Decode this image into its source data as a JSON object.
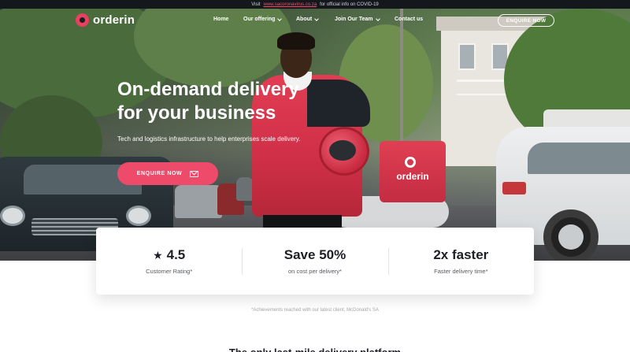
{
  "topbar": {
    "prefix": "Visit",
    "link_text": "www.sacoronavirus.co.za",
    "suffix": "for official info on COVID-19"
  },
  "nav": {
    "logo_text": "orderin",
    "links": [
      {
        "label": "Home",
        "has_dropdown": false
      },
      {
        "label": "Our offering",
        "has_dropdown": true
      },
      {
        "label": "About",
        "has_dropdown": true
      },
      {
        "label": "Join Our Team",
        "has_dropdown": true
      },
      {
        "label": "Contact us",
        "has_dropdown": false
      }
    ],
    "enquire_label": "ENQUIRE NOW"
  },
  "hero": {
    "title_line1": "On-demand delivery",
    "title_line2": "for your business",
    "subtitle": "Tech and logistics infrastructure to help enterprises scale delivery.",
    "cta_label": "ENQUIRE NOW",
    "box_brand": "orderin"
  },
  "stats": [
    {
      "value": "4.5",
      "label": "Customer Rating*",
      "icon": "star-icon"
    },
    {
      "value": "Save 50%",
      "label": "on cost per delivery*"
    },
    {
      "value": "2x faster",
      "label": "Faster delivery time*"
    }
  ],
  "footnote": "*Achievements reached with our latest client, McDonald's SA",
  "next_heading": "The only last-mile delivery platform",
  "colors": {
    "accent": "#ee4a6a",
    "topbar_bg": "#14171c",
    "text_dark": "#1d1f24"
  }
}
